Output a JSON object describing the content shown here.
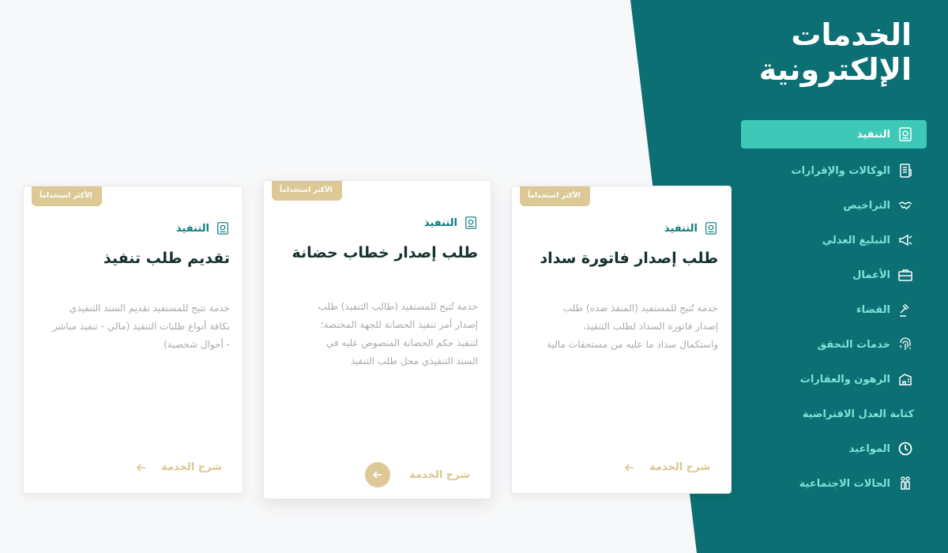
{
  "sidebar": {
    "title_line1": "الخدمات",
    "title_line2": "الإلكترونية",
    "items": [
      {
        "label": "التنفيذ",
        "icon": "execution-icon",
        "active": true
      },
      {
        "label": "الوكالات والإقرارات",
        "icon": "document-icon"
      },
      {
        "label": "التراخيص",
        "icon": "handshake-icon"
      },
      {
        "label": "التبليغ العدلي",
        "icon": "megaphone-icon"
      },
      {
        "label": "الأعمال",
        "icon": "briefcase-icon"
      },
      {
        "label": "القضاء",
        "icon": "gavel-icon"
      },
      {
        "label": "خدمات التحقق",
        "icon": "fingerprint-icon"
      },
      {
        "label": "الرهون والعقارات",
        "icon": "building-icon"
      },
      {
        "label": "كتابة العدل الافتراضية",
        "icon": ""
      },
      {
        "label": "المواعيد",
        "icon": "clock-icon"
      },
      {
        "label": "الحالات الاجتماعية",
        "icon": "family-icon"
      }
    ]
  },
  "cards": [
    {
      "badge": "الأكثر استخداماً",
      "category": "التنفيذ",
      "title": "طلب إصدار فاتورة سداد",
      "description_lines": [
        "خدمة تُتيح للمستفيد (المنفذ ضده) طلب",
        "إصدار فاتورة السداد لطلب التنفيذ،",
        "واستكمال سداد ما عليه من مستحقات مالية"
      ],
      "explain_label": "شرح الخدمة"
    },
    {
      "badge": "الأكثر استخداماً",
      "category": "التنفيذ",
      "title": "طلب إصدار خطاب حضانة",
      "description_lines": [
        "خدمة تُتيح للمستفيد (طالب التنفيذ) طلب",
        "إصدار أمر تنفيذ الحضانة للجهة المختصة؛",
        "لتنفيذ حكم الحضانة المنصوص عليه في",
        "السند التنفيذي محل طلب التنفيذ"
      ],
      "explain_label": "شرح الخدمة"
    },
    {
      "badge": "الأكثر استخداماً",
      "category": "التنفيذ",
      "title": "تقديم طلب تنفيذ",
      "description_lines": [
        "خدمة تتيح للمستفيد تقديم السند التنفيذي",
        "بكافة أنواع طلبات التنفيذ (مالي - تنفيذ مباشر",
        "- أحوال شخصية)"
      ],
      "explain_label": "شرح الخدمة"
    }
  ],
  "colors": {
    "teal": "#0b6f73",
    "active": "#3ec8b8",
    "gold": "#dcc996",
    "menu_text": "#7fe1d8"
  }
}
